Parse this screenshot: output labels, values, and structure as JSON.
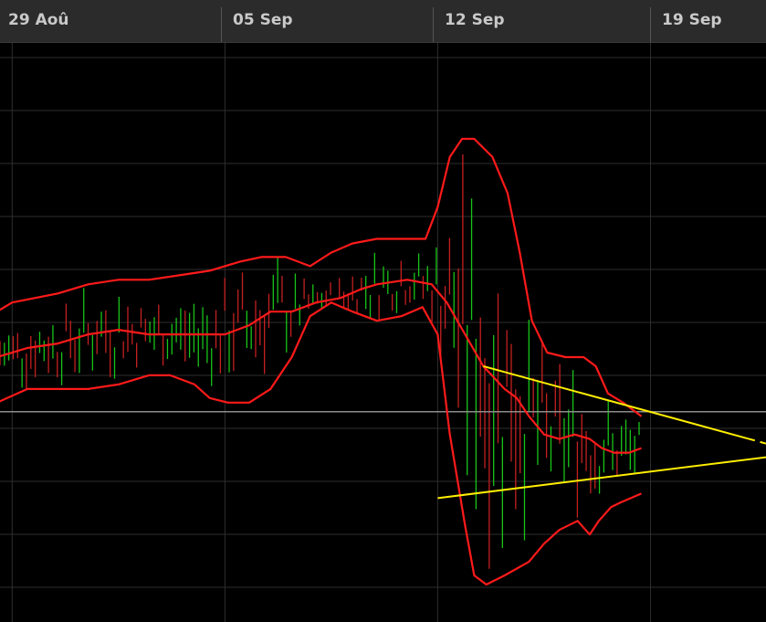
{
  "colors": {
    "background": "#000000",
    "header": "#2b2b2b",
    "grid": "#2e2e2e",
    "bollinger": "#ff1a1a",
    "trendline": "#ffee00",
    "bar_up": "#18c418",
    "bar_down": "#c42020",
    "price_line": "#8c8c8c"
  },
  "chart_data": {
    "type": "line",
    "x_axis": {
      "kind": "date",
      "tick_labels": [
        "29 Aoû",
        "05 Sep",
        "12 Sep",
        "19 Sep"
      ],
      "tick_days": [
        29,
        36,
        43,
        50
      ],
      "range_days": [
        28.6,
        53.8
      ]
    },
    "y_axis": {
      "range": [
        0,
        100
      ],
      "labels_visible": false,
      "grid": true
    },
    "price_line": 38,
    "bollinger": {
      "upper": [
        [
          28.5,
          60
        ],
        [
          29.0,
          62
        ],
        [
          30.5,
          64
        ],
        [
          31.5,
          66
        ],
        [
          32.5,
          67
        ],
        [
          33.5,
          67
        ],
        [
          34.5,
          68
        ],
        [
          35.5,
          69
        ],
        [
          36.5,
          71
        ],
        [
          37.2,
          72
        ],
        [
          38.0,
          72
        ],
        [
          38.8,
          70
        ],
        [
          39.5,
          73
        ],
        [
          40.2,
          75
        ],
        [
          41.0,
          76
        ],
        [
          42.0,
          76
        ],
        [
          42.6,
          76
        ],
        [
          43.0,
          83
        ],
        [
          43.4,
          94
        ],
        [
          43.8,
          98
        ],
        [
          44.2,
          98
        ],
        [
          44.8,
          94
        ],
        [
          45.3,
          86
        ],
        [
          45.7,
          73
        ],
        [
          46.1,
          58
        ],
        [
          46.6,
          51
        ],
        [
          47.2,
          50
        ],
        [
          47.8,
          50
        ],
        [
          48.2,
          48
        ],
        [
          48.6,
          42
        ],
        [
          49.1,
          40
        ],
        [
          49.7,
          37
        ]
      ],
      "middle": [
        [
          28.5,
          50
        ],
        [
          29.5,
          52
        ],
        [
          30.5,
          53
        ],
        [
          31.5,
          55
        ],
        [
          32.5,
          56
        ],
        [
          33.5,
          55
        ],
        [
          34.5,
          55
        ],
        [
          35.3,
          55
        ],
        [
          36.0,
          55
        ],
        [
          36.8,
          57
        ],
        [
          37.5,
          60
        ],
        [
          38.2,
          60
        ],
        [
          39.0,
          62
        ],
        [
          39.8,
          63
        ],
        [
          40.5,
          65
        ],
        [
          41.0,
          66
        ],
        [
          42.0,
          67
        ],
        [
          42.8,
          66
        ],
        [
          43.3,
          62
        ],
        [
          43.9,
          55
        ],
        [
          44.5,
          48
        ],
        [
          45.2,
          43
        ],
        [
          45.6,
          41
        ],
        [
          46.0,
          37
        ],
        [
          46.5,
          33
        ],
        [
          47.0,
          32
        ],
        [
          47.5,
          33
        ],
        [
          48.0,
          32
        ],
        [
          48.4,
          30
        ],
        [
          48.8,
          29
        ],
        [
          49.3,
          29
        ],
        [
          49.7,
          30
        ]
      ],
      "lower": [
        [
          28.5,
          40
        ],
        [
          29.5,
          43
        ],
        [
          30.5,
          43
        ],
        [
          31.5,
          43
        ],
        [
          32.5,
          44
        ],
        [
          33.5,
          46
        ],
        [
          34.2,
          46
        ],
        [
          35.0,
          44
        ],
        [
          35.5,
          41
        ],
        [
          36.1,
          40
        ],
        [
          36.8,
          40
        ],
        [
          37.5,
          43
        ],
        [
          38.2,
          50
        ],
        [
          38.8,
          59
        ],
        [
          39.5,
          62
        ],
        [
          40.2,
          60
        ],
        [
          41.0,
          58
        ],
        [
          41.8,
          59
        ],
        [
          42.5,
          61
        ],
        [
          43.0,
          55
        ],
        [
          43.4,
          33
        ],
        [
          43.9,
          13
        ],
        [
          44.2,
          2
        ],
        [
          44.6,
          0
        ],
        [
          45.2,
          2
        ],
        [
          46.0,
          5
        ],
        [
          46.5,
          9
        ],
        [
          47.0,
          12
        ],
        [
          47.6,
          14
        ],
        [
          48.0,
          11
        ],
        [
          48.3,
          14
        ],
        [
          48.7,
          17
        ],
        [
          49.0,
          18
        ],
        [
          49.7,
          20
        ]
      ]
    },
    "trendlines": [
      {
        "points": [
          [
            44.5,
            48
          ],
          [
            53.8,
            31
          ]
        ],
        "dashed_after": 53.2
      },
      {
        "points": [
          [
            43.0,
            19
          ],
          [
            53.8,
            28
          ]
        ]
      }
    ]
  }
}
